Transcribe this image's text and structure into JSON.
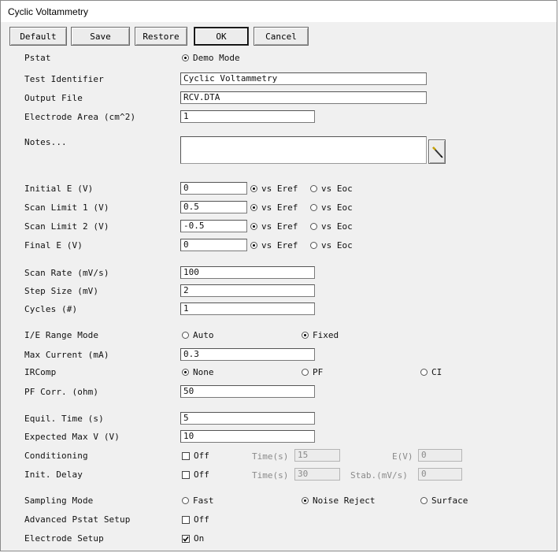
{
  "window": {
    "title": "Cyclic Voltammetry"
  },
  "toolbar": {
    "default": "Default",
    "save": "Save",
    "restore": "Restore",
    "ok": "OK",
    "cancel": "Cancel"
  },
  "vs_eref": "vs Eref",
  "vs_eoc": "vs Eoc",
  "time_label": "Time(s)",
  "pstat": {
    "label": "Pstat",
    "option": "Demo Mode"
  },
  "test_identifier": {
    "label": "Test Identifier",
    "value": "Cyclic Voltammetry"
  },
  "output_file": {
    "label": "Output File",
    "value": "RCV.DTA"
  },
  "electrode_area": {
    "label": "Electrode Area (cm^2)",
    "value": "1"
  },
  "notes": {
    "label": "Notes...",
    "value": ""
  },
  "initial_e": {
    "label": "Initial E (V)",
    "value": "0"
  },
  "scan_limit_1": {
    "label": "Scan Limit 1 (V)",
    "value": "0.5"
  },
  "scan_limit_2": {
    "label": "Scan Limit 2 (V)",
    "value": "-0.5"
  },
  "final_e": {
    "label": "Final E (V)",
    "value": "0"
  },
  "scan_rate": {
    "label": "Scan Rate (mV/s)",
    "value": "100"
  },
  "step_size": {
    "label": "Step Size (mV)",
    "value": "2"
  },
  "cycles": {
    "label": "Cycles (#)",
    "value": "1"
  },
  "ie_range_mode": {
    "label": "I/E Range Mode",
    "auto": "Auto",
    "fixed": "Fixed",
    "selected": "Fixed"
  },
  "max_current": {
    "label": "Max Current (mA)",
    "value": "0.3"
  },
  "ircomp": {
    "label": "IRComp",
    "none": "None",
    "pf": "PF",
    "ci": "CI",
    "selected": "None"
  },
  "pf_corr": {
    "label": "PF Corr. (ohm)",
    "value": "50"
  },
  "equil_time": {
    "label": "Equil. Time (s)",
    "value": "5"
  },
  "expected_max_v": {
    "label": "Expected Max V (V)",
    "value": "10"
  },
  "conditioning": {
    "label": "Conditioning",
    "check_label": "Off",
    "checked": false,
    "time_value": "15",
    "e_label": "E(V)",
    "e_value": "0"
  },
  "init_delay": {
    "label": "Init. Delay",
    "check_label": "Off",
    "checked": false,
    "time_value": "30",
    "stab_label": "Stab.(mV/s)",
    "stab_value": "0"
  },
  "sampling_mode": {
    "label": "Sampling Mode",
    "fast": "Fast",
    "noise_reject": "Noise Reject",
    "surface": "Surface",
    "selected": "Noise Reject"
  },
  "advanced_pstat": {
    "label": "Advanced Pstat Setup",
    "check_label": "Off",
    "checked": false
  },
  "electrode_setup": {
    "label": "Electrode Setup",
    "check_label": "On",
    "checked": true
  }
}
